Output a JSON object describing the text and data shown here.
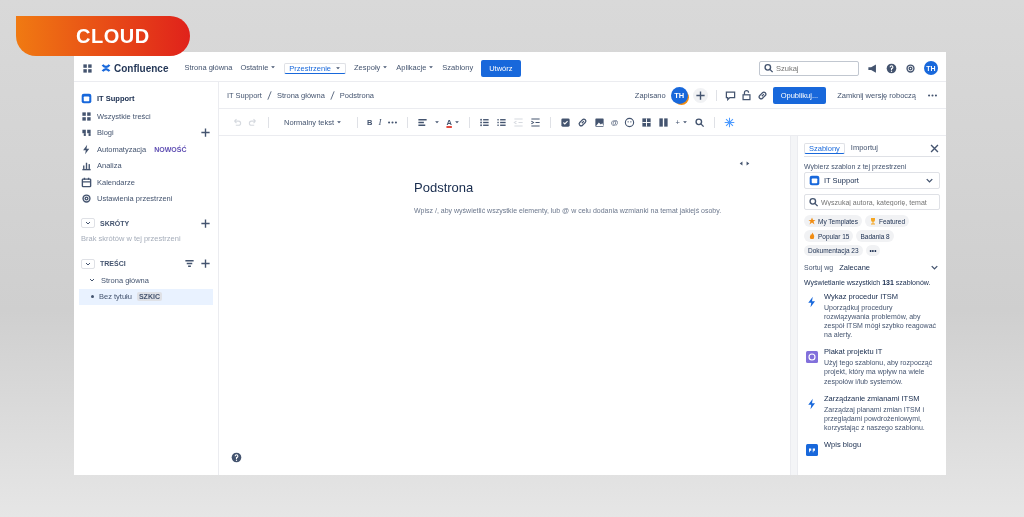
{
  "badge": "CLOUD",
  "top_nav": {
    "logo": "Confluence",
    "items": [
      {
        "label": "Strona główna",
        "dropdown": false,
        "selected": false
      },
      {
        "label": "Ostatnie",
        "dropdown": true,
        "selected": false
      },
      {
        "label": "Przestrzenie",
        "dropdown": true,
        "selected": true
      },
      {
        "label": "Zespoły",
        "dropdown": true,
        "selected": false
      },
      {
        "label": "Aplikacje",
        "dropdown": true,
        "selected": false
      },
      {
        "label": "Szablony",
        "dropdown": false,
        "selected": false
      }
    ],
    "create_button": "Utwórz",
    "search": {
      "placeholder": "Szukaj"
    },
    "avatar": "TH"
  },
  "sidebar": {
    "space": "IT Support",
    "items": [
      {
        "kind": "grid",
        "label": "Wszystkie treści",
        "add": false
      },
      {
        "kind": "quote",
        "label": "Blogi",
        "add": true
      },
      {
        "kind": "bolt",
        "label": "Automatyzacja",
        "badge": "NOWOŚĆ",
        "add": false
      },
      {
        "kind": "chart",
        "label": "Analiza",
        "add": false
      },
      {
        "kind": "calendar",
        "label": "Kalendarze",
        "add": false
      },
      {
        "kind": "gear",
        "label": "Ustawienia przestrzeni",
        "add": false
      }
    ],
    "shortcuts": {
      "title": "SKRÓTY",
      "expanded": true,
      "empty": "Brak skrótów w tej przestrzeni"
    },
    "content": {
      "title": "TREŚCI",
      "expanded": true,
      "tree": [
        {
          "label": "Strona główna",
          "expanded": true,
          "selected": false,
          "children": [
            {
              "label": "Bez tytułu",
              "badge": "SZKIC",
              "selected": true
            }
          ]
        }
      ]
    }
  },
  "editor": {
    "breadcrumbs": [
      "IT Support",
      "Strona główna",
      "Podstrona"
    ],
    "status": "Zapisano",
    "avatar": "TH",
    "publish_button": "Opublikuj...",
    "close_draft": "Zamknij wersję roboczą",
    "toolbar": [
      {
        "kind": "undo",
        "disabled": true
      },
      {
        "kind": "redo",
        "disabled": true
      },
      {
        "kind": "style",
        "label": "Normalny tekst",
        "disabled": false
      },
      {
        "kind": "bold",
        "label": "B",
        "disabled": false
      },
      {
        "kind": "italic",
        "label": "I",
        "disabled": false
      },
      {
        "kind": "more",
        "disabled": false
      },
      {
        "kind": "align",
        "disabled": false
      },
      {
        "kind": "color",
        "label": "A",
        "disabled": false
      },
      {
        "kind": "bullets",
        "disabled": false
      },
      {
        "kind": "numbers",
        "disabled": false
      },
      {
        "kind": "outdent",
        "disabled": true
      },
      {
        "kind": "indent",
        "disabled": false
      },
      {
        "kind": "task",
        "disabled": false
      },
      {
        "kind": "link",
        "disabled": false
      },
      {
        "kind": "image",
        "disabled": false
      },
      {
        "kind": "mention",
        "label": "@",
        "disabled": false
      },
      {
        "kind": "emoji",
        "disabled": false
      },
      {
        "kind": "table",
        "disabled": false
      },
      {
        "kind": "layout",
        "disabled": false
      },
      {
        "kind": "insert",
        "label": "+",
        "disabled": false
      },
      {
        "kind": "find",
        "disabled": false
      },
      {
        "kind": "ai",
        "disabled": false
      }
    ],
    "title": "Podstrona",
    "placeholder": "Wpisz /, aby wyświetlić wszystkie elementy, lub @ w celu dodania wzmianki na temat jakiejś osoby."
  },
  "templates_panel": {
    "tabs": [
      {
        "label": "Szablony",
        "selected": true
      },
      {
        "label": "Importuj",
        "selected": false
      }
    ],
    "space_label": "Wybierz szablon z tej przestrzeni",
    "space": "IT Support",
    "search": {
      "placeholder": "Wyszukaj autora, kategorię, temat"
    },
    "chips": [
      {
        "kind": "star",
        "label": "My Templates"
      },
      {
        "kind": "trophy",
        "label": "Featured"
      },
      {
        "kind": "fire",
        "label": "Popular 15"
      },
      {
        "kind": "plain",
        "label": "Badania 8"
      },
      {
        "kind": "plain",
        "label": "Dokumentacja 23"
      },
      {
        "kind": "plain",
        "label": "•••"
      }
    ],
    "sort_label": "Sortuj wg",
    "sort": "Zalecane",
    "count": "Wyświetlanie wszystkich **131** szablonów.",
    "templates": [
      {
        "kind": "bolt",
        "title": "Wykaz procedur ITSM",
        "description": "Uporządkuj procedury rozwiązywania problemów, aby zespół ITSM mógł szybko reagować na alerty."
      },
      {
        "kind": "target",
        "title": "Plakat projektu IT",
        "description": "Użyj tego szablonu, aby rozpocząć projekt, który ma wpływ na wiele zespołów i/lub systemów."
      },
      {
        "kind": "bolt",
        "title": "Zarządzanie zmianami ITSM",
        "description": "Zarządzaj planami zmian ITSM i przeglądami powdrożeniowymi, korzystając z naszego szablonu."
      },
      {
        "kind": "quote",
        "title": "Wpis blogu"
      }
    ]
  }
}
